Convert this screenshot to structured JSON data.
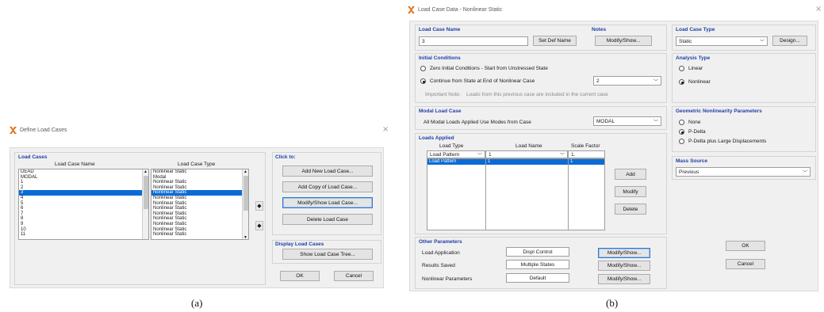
{
  "dialog_a": {
    "title": "Define Load Cases",
    "close": "×",
    "load_cases_group": "Load Cases",
    "col_name": "Load Case Name",
    "col_type": "Load Case Type",
    "names": [
      "DEAD",
      "MODAL",
      "1",
      "2",
      "3",
      "4",
      "5",
      "6",
      "7",
      "8",
      "9",
      "10",
      "11"
    ],
    "types": [
      "Nonlinear Static",
      "Modal",
      "Nonlinear Static",
      "Nonlinear Static",
      "Nonlinear Static",
      "Nonlinear Static",
      "Nonlinear Static",
      "Nonlinear Static",
      "Nonlinear Static",
      "Nonlinear Static",
      "Nonlinear Static",
      "Nonlinear Static",
      "Nonlinear Static"
    ],
    "selected_index": 4,
    "click_to_group": "Click to:",
    "btn_add_new": "Add New Load Case...",
    "btn_add_copy": "Add Copy of Load Case...",
    "btn_modify_show": "Modify/Show Load Case...",
    "btn_delete": "Delete Load Case",
    "display_group": "Display Load Cases",
    "btn_show_tree": "Show Load Case Tree...",
    "ok": "OK",
    "cancel": "Cancel",
    "caption": "(a)"
  },
  "dialog_b": {
    "title": "Load Case Data - Nonlinear Static",
    "close": "×",
    "load_case_name_label": "Load Case Name",
    "load_case_name_value": "3",
    "set_def_name": "Set Def Name",
    "notes_label": "Notes",
    "notes_btn": "Modify/Show...",
    "load_case_type_label": "Load Case Type",
    "load_case_type_value": "Static",
    "design_btn": "Design...",
    "initial_conditions_label": "Initial Conditions",
    "ic_zero": "Zero Initial Conditions - Start from Unstressed State",
    "ic_continue": "Continue from State at End of Nonlinear Case",
    "ic_continue_value": "2",
    "important_note_label": "Important Note:",
    "important_note_text": "Loads from this previous case are included in the current case",
    "analysis_type_label": "Analysis Type",
    "at_linear": "Linear",
    "at_nonlinear": "Nonlinear",
    "modal_load_case_label": "Modal Load Case",
    "modal_text": "All Modal Loads Applied Use Modes from Case",
    "modal_value": "MODAL",
    "geom_label": "Geometric Nonlinearity Parameters",
    "geom_none": "None",
    "geom_pdelta": "P-Delta",
    "geom_pdelta_large": "P-Delta plus Large Displacements",
    "loads_applied_label": "Loads Applied",
    "col_load_type": "Load Type",
    "col_load_name": "Load Name",
    "col_scale_factor": "Scale Factor",
    "edit_load_type": "Load Pattern",
    "edit_load_name": "1",
    "edit_scale_factor": "1.",
    "row_load_type": "Load Pattern",
    "row_load_name": "1",
    "row_scale_factor": "1",
    "add_btn": "Add",
    "modify_btn": "Modify",
    "delete_btn": "Delete",
    "mass_source_label": "Mass Source",
    "mass_source_value": "Previous",
    "other_params_label": "Other Parameters",
    "load_application_label": "Load Application",
    "load_application_value": "Displ Control",
    "results_saved_label": "Results Saved",
    "results_saved_value": "Multiple States",
    "nonlinear_params_label": "Nonlinear Parameters",
    "nonlinear_params_value": "Default",
    "modify_show_1": "Modify/Show...",
    "modify_show_2": "Modify/Show...",
    "modify_show_3": "Modify/Show...",
    "ok": "OK",
    "cancel": "Cancel",
    "caption": "(b)"
  },
  "colors": {
    "group_label": "#1f3fa8",
    "selection": "#0a6bd6",
    "app_icon": "#e0701a"
  },
  "icons": [
    "app-logo-icon",
    "close-icon",
    "dropdown-arrow-icon",
    "scroll-up-icon",
    "scroll-down-icon"
  ]
}
